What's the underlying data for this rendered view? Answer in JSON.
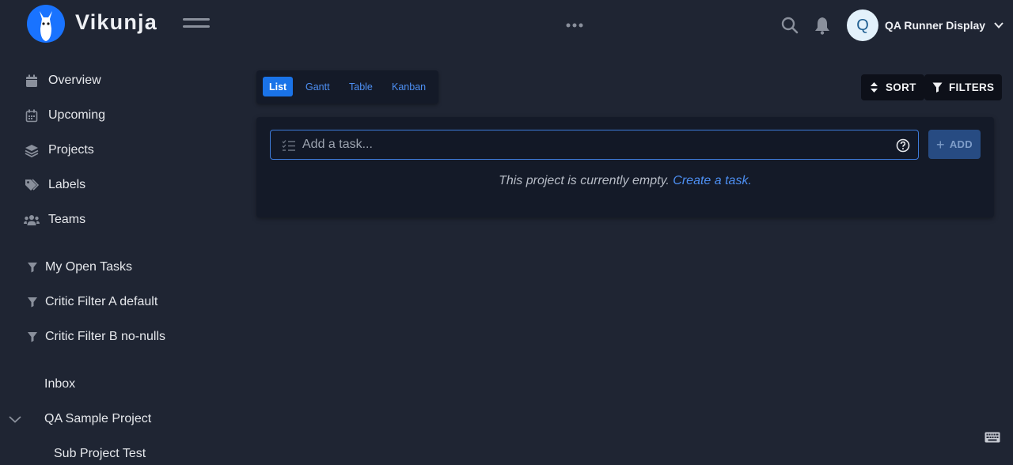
{
  "app": {
    "brand": "Vikunja",
    "accent_color": "#1a73e8",
    "logo_icon": "llama-logo-icon"
  },
  "header": {
    "more_icon": "more-dots-icon",
    "search_icon": "search-icon",
    "notifications_icon": "bell-icon",
    "user": {
      "avatar_letter": "Q",
      "name": "QA Runner Display"
    }
  },
  "sidebar": {
    "nav": [
      {
        "label": "Overview",
        "icon": "calendar-day-icon"
      },
      {
        "label": "Upcoming",
        "icon": "calendar-icon"
      },
      {
        "label": "Projects",
        "icon": "layers-icon"
      },
      {
        "label": "Labels",
        "icon": "tags-icon"
      },
      {
        "label": "Teams",
        "icon": "users-icon"
      }
    ],
    "filters": [
      {
        "label": "My Open Tasks",
        "icon": "filter-icon"
      },
      {
        "label": "Critic Filter A default",
        "icon": "filter-icon"
      },
      {
        "label": "Critic Filter B no-nulls",
        "icon": "filter-icon"
      }
    ],
    "projects": [
      {
        "label": "Inbox"
      },
      {
        "label": "QA Sample Project"
      },
      {
        "label": "Sub Project Test"
      }
    ]
  },
  "project_view": {
    "views": [
      "List",
      "Gantt",
      "Table",
      "Kanban"
    ],
    "active_view": "List",
    "sort_label": "SORT",
    "filters_label": "FILTERS",
    "task_input": {
      "placeholder": "Add a task...",
      "value": ""
    },
    "add_label": "ADD",
    "empty_text": "This project is currently empty.",
    "empty_link": "Create a task."
  }
}
